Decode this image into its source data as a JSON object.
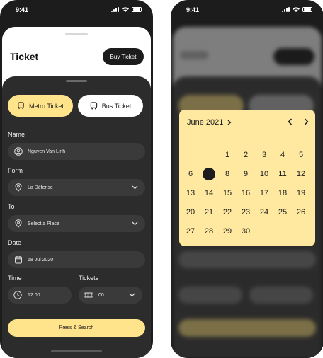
{
  "status": {
    "time": "9:41"
  },
  "ticket": {
    "title": "Ticket",
    "buy_button": "Buy Ticket",
    "tabs": {
      "metro": "Metro Ticket",
      "bus": "Bus Ticket"
    },
    "name": {
      "label": "Name",
      "value": "Nguyen Van Linh"
    },
    "form": {
      "label": "Form",
      "value": "La Défense"
    },
    "to": {
      "label": "To",
      "value": "Select a Place"
    },
    "date": {
      "label": "Date",
      "value": "18 Jul 2020"
    },
    "time": {
      "label": "Time",
      "value": "12:00"
    },
    "tickets": {
      "label": "Tickets",
      "value": "00"
    },
    "search_button": "Press & Search"
  },
  "calendar": {
    "month": "June 2021",
    "selected_day": 7,
    "days": [
      "",
      "",
      "1",
      "2",
      "3",
      "4",
      "5",
      "6",
      "7",
      "8",
      "9",
      "10",
      "11",
      "12",
      "13",
      "14",
      "15",
      "16",
      "17",
      "18",
      "19",
      "20",
      "21",
      "22",
      "23",
      "24",
      "25",
      "26",
      "27",
      "28",
      "29",
      "30"
    ]
  },
  "colors": {
    "accent": "#ffe48c",
    "dark": "#1c1c1c",
    "panel": "#2c2c2c"
  }
}
